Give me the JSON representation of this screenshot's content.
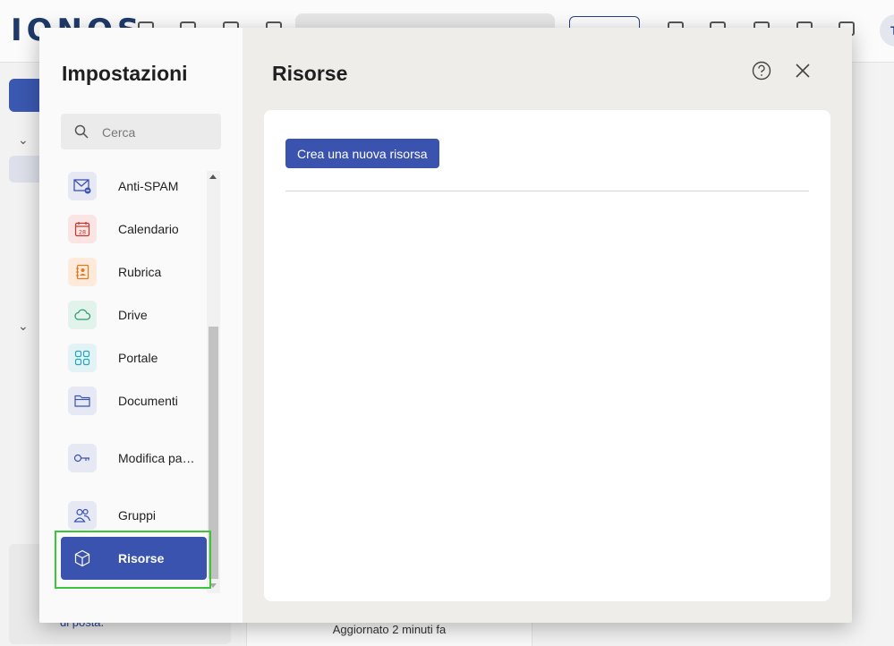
{
  "background": {
    "logo": "IONOS",
    "avatar_initial": "T",
    "promo_text": "di posta.",
    "status": "Aggiornato 2 minuti fa"
  },
  "settings": {
    "sidebar_title": "Impostazioni",
    "search_placeholder": "Cerca",
    "items": [
      {
        "label": "Anti-SPAM",
        "icon": "mail-spam-icon",
        "icon_bg": "#e6e9f4",
        "icon_color": "#3a53af"
      },
      {
        "label": "Calendario",
        "icon": "calendar-icon",
        "icon_bg": "#fbe4e4",
        "icon_color": "#c0392b",
        "icon_text": "28"
      },
      {
        "label": "Rubrica",
        "icon": "address-book-icon",
        "icon_bg": "#fdeadb",
        "icon_color": "#e07a1f"
      },
      {
        "label": "Drive",
        "icon": "cloud-icon",
        "icon_bg": "#e2f3ec",
        "icon_color": "#2b9c6c"
      },
      {
        "label": "Portale",
        "icon": "grid-icon",
        "icon_bg": "#e2f3f5",
        "icon_color": "#2aa6b8"
      },
      {
        "label": "Documenti",
        "icon": "folder-icon",
        "icon_bg": "#e6e9f4",
        "icon_color": "#3a53af"
      },
      {
        "label": "Modifica password",
        "icon": "key-icon",
        "icon_bg": "#e6e9f4",
        "icon_color": "#3a53af"
      },
      {
        "label": "Gruppi",
        "icon": "users-icon",
        "icon_bg": "#e6e9f4",
        "icon_color": "#3a53af"
      },
      {
        "label": "Risorse",
        "icon": "cube-icon",
        "active": true
      }
    ]
  },
  "content": {
    "title": "Risorse",
    "create_button": "Crea una nuova risorsa"
  },
  "colors": {
    "accent": "#3a53af",
    "focus_ring": "#3cc43c"
  }
}
